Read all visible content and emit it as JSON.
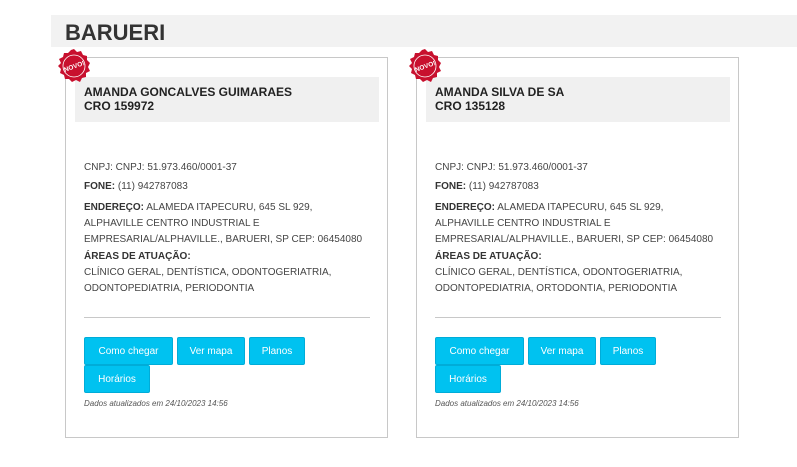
{
  "city": "BARUERI",
  "badge_text": "NOVO!",
  "colors": {
    "button_bg": "#00c2f0",
    "badge_red": "#c8102e",
    "header_bg": "#f2f2f2"
  },
  "cards": [
    {
      "name": "AMANDA GONCALVES GUIMARAES",
      "cro": "CRO 159972",
      "cnpj": "CNPJ: CNPJ: 51.973.460/0001-37",
      "fone_label": "FONE:",
      "fone": "(11) 942787083",
      "endereco_label": "ENDEREÇO:",
      "endereco_line1": "ALAMEDA ITAPECURU, 645 SL 929,",
      "endereco_line2": "ALPHAVILLE CENTRO INDUSTRIAL E",
      "endereco_line3": "EMPRESARIAL/ALPHAVILLE., BARUERI, SP CEP: 06454080",
      "areas_label": "ÁREAS DE ATUAÇÃO:",
      "areas_line1": "CLÍNICO GERAL, DENTÍSTICA, ODONTOGERIATRIA,",
      "areas_line2": "ODONTOPEDIATRIA, PERIODONTIA",
      "buttons": {
        "chegar": "Como chegar",
        "mapa": "Ver mapa",
        "planos": "Planos",
        "horarios": "Horários"
      },
      "updated": "Dados atualizados em 24/10/2023 14:56"
    },
    {
      "name": "AMANDA SILVA DE SA",
      "cro": "CRO 135128",
      "cnpj": "CNPJ: CNPJ: 51.973.460/0001-37",
      "fone_label": "FONE:",
      "fone": "(11) 942787083",
      "endereco_label": "ENDEREÇO:",
      "endereco_line1": "ALAMEDA ITAPECURU, 645 SL 929,",
      "endereco_line2": "ALPHAVILLE CENTRO INDUSTRIAL E",
      "endereco_line3": "EMPRESARIAL/ALPHAVILLE., BARUERI, SP CEP: 06454080",
      "areas_label": "ÁREAS DE ATUAÇÃO:",
      "areas_line1": "CLÍNICO GERAL, DENTÍSTICA, ODONTOGERIATRIA,",
      "areas_line2": "ODONTOPEDIATRIA, ORTODONTIA, PERIODONTIA",
      "buttons": {
        "chegar": "Como chegar",
        "mapa": "Ver mapa",
        "planos": "Planos",
        "horarios": "Horários"
      },
      "updated": "Dados atualizados em 24/10/2023 14:56"
    }
  ]
}
